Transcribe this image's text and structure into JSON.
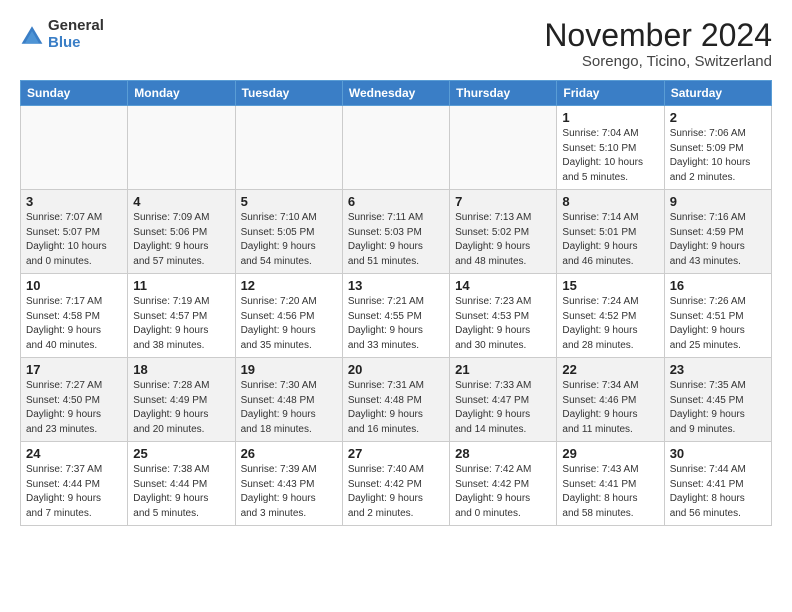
{
  "logo": {
    "general": "General",
    "blue": "Blue"
  },
  "title": "November 2024",
  "location": "Sorengo, Ticino, Switzerland",
  "days_of_week": [
    "Sunday",
    "Monday",
    "Tuesday",
    "Wednesday",
    "Thursday",
    "Friday",
    "Saturday"
  ],
  "weeks": [
    [
      {
        "day": "",
        "info": ""
      },
      {
        "day": "",
        "info": ""
      },
      {
        "day": "",
        "info": ""
      },
      {
        "day": "",
        "info": ""
      },
      {
        "day": "",
        "info": ""
      },
      {
        "day": "1",
        "info": "Sunrise: 7:04 AM\nSunset: 5:10 PM\nDaylight: 10 hours\nand 5 minutes."
      },
      {
        "day": "2",
        "info": "Sunrise: 7:06 AM\nSunset: 5:09 PM\nDaylight: 10 hours\nand 2 minutes."
      }
    ],
    [
      {
        "day": "3",
        "info": "Sunrise: 7:07 AM\nSunset: 5:07 PM\nDaylight: 10 hours\nand 0 minutes."
      },
      {
        "day": "4",
        "info": "Sunrise: 7:09 AM\nSunset: 5:06 PM\nDaylight: 9 hours\nand 57 minutes."
      },
      {
        "day": "5",
        "info": "Sunrise: 7:10 AM\nSunset: 5:05 PM\nDaylight: 9 hours\nand 54 minutes."
      },
      {
        "day": "6",
        "info": "Sunrise: 7:11 AM\nSunset: 5:03 PM\nDaylight: 9 hours\nand 51 minutes."
      },
      {
        "day": "7",
        "info": "Sunrise: 7:13 AM\nSunset: 5:02 PM\nDaylight: 9 hours\nand 48 minutes."
      },
      {
        "day": "8",
        "info": "Sunrise: 7:14 AM\nSunset: 5:01 PM\nDaylight: 9 hours\nand 46 minutes."
      },
      {
        "day": "9",
        "info": "Sunrise: 7:16 AM\nSunset: 4:59 PM\nDaylight: 9 hours\nand 43 minutes."
      }
    ],
    [
      {
        "day": "10",
        "info": "Sunrise: 7:17 AM\nSunset: 4:58 PM\nDaylight: 9 hours\nand 40 minutes."
      },
      {
        "day": "11",
        "info": "Sunrise: 7:19 AM\nSunset: 4:57 PM\nDaylight: 9 hours\nand 38 minutes."
      },
      {
        "day": "12",
        "info": "Sunrise: 7:20 AM\nSunset: 4:56 PM\nDaylight: 9 hours\nand 35 minutes."
      },
      {
        "day": "13",
        "info": "Sunrise: 7:21 AM\nSunset: 4:55 PM\nDaylight: 9 hours\nand 33 minutes."
      },
      {
        "day": "14",
        "info": "Sunrise: 7:23 AM\nSunset: 4:53 PM\nDaylight: 9 hours\nand 30 minutes."
      },
      {
        "day": "15",
        "info": "Sunrise: 7:24 AM\nSunset: 4:52 PM\nDaylight: 9 hours\nand 28 minutes."
      },
      {
        "day": "16",
        "info": "Sunrise: 7:26 AM\nSunset: 4:51 PM\nDaylight: 9 hours\nand 25 minutes."
      }
    ],
    [
      {
        "day": "17",
        "info": "Sunrise: 7:27 AM\nSunset: 4:50 PM\nDaylight: 9 hours\nand 23 minutes."
      },
      {
        "day": "18",
        "info": "Sunrise: 7:28 AM\nSunset: 4:49 PM\nDaylight: 9 hours\nand 20 minutes."
      },
      {
        "day": "19",
        "info": "Sunrise: 7:30 AM\nSunset: 4:48 PM\nDaylight: 9 hours\nand 18 minutes."
      },
      {
        "day": "20",
        "info": "Sunrise: 7:31 AM\nSunset: 4:48 PM\nDaylight: 9 hours\nand 16 minutes."
      },
      {
        "day": "21",
        "info": "Sunrise: 7:33 AM\nSunset: 4:47 PM\nDaylight: 9 hours\nand 14 minutes."
      },
      {
        "day": "22",
        "info": "Sunrise: 7:34 AM\nSunset: 4:46 PM\nDaylight: 9 hours\nand 11 minutes."
      },
      {
        "day": "23",
        "info": "Sunrise: 7:35 AM\nSunset: 4:45 PM\nDaylight: 9 hours\nand 9 minutes."
      }
    ],
    [
      {
        "day": "24",
        "info": "Sunrise: 7:37 AM\nSunset: 4:44 PM\nDaylight: 9 hours\nand 7 minutes."
      },
      {
        "day": "25",
        "info": "Sunrise: 7:38 AM\nSunset: 4:44 PM\nDaylight: 9 hours\nand 5 minutes."
      },
      {
        "day": "26",
        "info": "Sunrise: 7:39 AM\nSunset: 4:43 PM\nDaylight: 9 hours\nand 3 minutes."
      },
      {
        "day": "27",
        "info": "Sunrise: 7:40 AM\nSunset: 4:42 PM\nDaylight: 9 hours\nand 2 minutes."
      },
      {
        "day": "28",
        "info": "Sunrise: 7:42 AM\nSunset: 4:42 PM\nDaylight: 9 hours\nand 0 minutes."
      },
      {
        "day": "29",
        "info": "Sunrise: 7:43 AM\nSunset: 4:41 PM\nDaylight: 8 hours\nand 58 minutes."
      },
      {
        "day": "30",
        "info": "Sunrise: 7:44 AM\nSunset: 4:41 PM\nDaylight: 8 hours\nand 56 minutes."
      }
    ]
  ]
}
